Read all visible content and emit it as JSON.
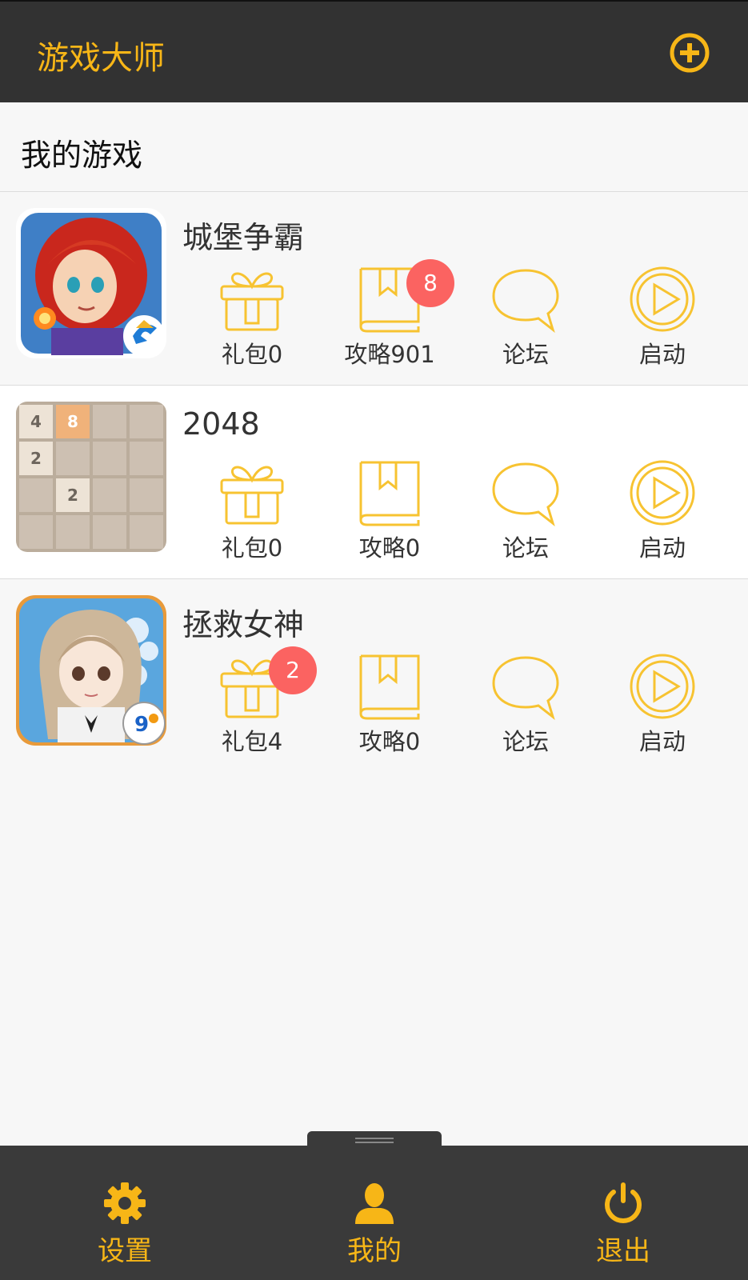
{
  "header": {
    "title": "游戏大师",
    "add_icon": "plus-circle-icon",
    "accent_color": "#f7b617",
    "bar_color": "#323232"
  },
  "section": {
    "title": "我的游戏"
  },
  "games": [
    {
      "name": "城堡争霸",
      "icon": "castle-clash-game-icon",
      "actions": [
        {
          "label": "礼包0",
          "icon": "gift-icon",
          "badge": ""
        },
        {
          "label": "攻略901",
          "icon": "book-icon",
          "badge": "8"
        },
        {
          "label": "论坛",
          "icon": "chat-bubble-icon",
          "badge": ""
        },
        {
          "label": "启动",
          "icon": "play-circle-icon",
          "badge": ""
        }
      ]
    },
    {
      "name": "2048",
      "icon": "2048-game-icon",
      "tiles": [
        "4",
        "8",
        "",
        "",
        "2",
        "",
        "",
        "",
        "",
        "2",
        "",
        "",
        "",
        "",
        "",
        ""
      ],
      "actions": [
        {
          "label": "礼包0",
          "icon": "gift-icon",
          "badge": ""
        },
        {
          "label": "攻略0",
          "icon": "book-icon",
          "badge": ""
        },
        {
          "label": "论坛",
          "icon": "chat-bubble-icon",
          "badge": ""
        },
        {
          "label": "启动",
          "icon": "play-circle-icon",
          "badge": ""
        }
      ]
    },
    {
      "name": "拯救女神",
      "icon": "save-goddess-game-icon",
      "actions": [
        {
          "label": "礼包4",
          "icon": "gift-icon",
          "badge": "2"
        },
        {
          "label": "攻略0",
          "icon": "book-icon",
          "badge": ""
        },
        {
          "label": "论坛",
          "icon": "chat-bubble-icon",
          "badge": ""
        },
        {
          "label": "启动",
          "icon": "play-circle-icon",
          "badge": ""
        }
      ]
    }
  ],
  "bottom_nav": [
    {
      "label": "设置",
      "icon": "gear-icon"
    },
    {
      "label": "我的",
      "icon": "user-icon"
    },
    {
      "label": "退出",
      "icon": "power-icon"
    }
  ],
  "colors": {
    "badge": "#fb6361",
    "icon_stroke": "#f7c331",
    "background": "#f7f7f7"
  }
}
